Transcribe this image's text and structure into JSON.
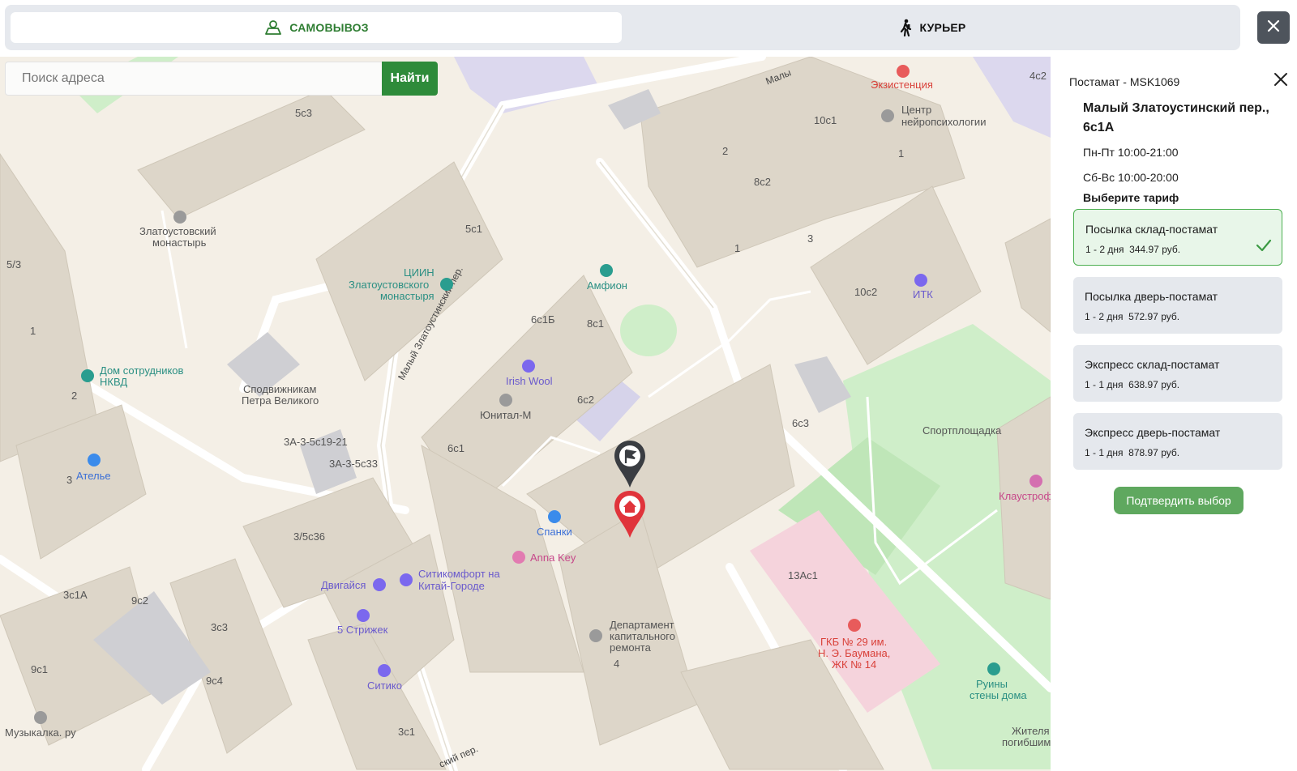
{
  "tabs": {
    "pickup_label": "САМОВЫВОЗ",
    "courier_label": "КУРЬЕР"
  },
  "search": {
    "placeholder": "Поиск адреса",
    "button_label": "Найти"
  },
  "map": {
    "labels": {
      "l_5c3": "5с3",
      "l_10c1": "10с1",
      "l_8c2": "8с2",
      "l_5c1": "5с1",
      "l_53": "5/3",
      "l_6c1b": "6с1Б",
      "l_8c1": "8с1",
      "l_10c2": "10с2",
      "l_6c2": "6с2",
      "l_6c3": "6с3",
      "l_6c1": "6с1",
      "l_3a19": "3А-3-5с19-21",
      "l_3a33": "3А-3-5с33",
      "l_35c36": "3/5с36",
      "l_3c1a": "3с1А",
      "l_9c2": "9с2",
      "l_3c3": "3с3",
      "l_9c1": "9с1",
      "l_9c4": "9с4",
      "l_3c1": "3с1",
      "l_13ac1": "13Ас1",
      "l_4": "4",
      "l_4c2": "4с2",
      "n_2a": "2",
      "n_1a": "1",
      "n_1b": "1",
      "n_3a": "3",
      "n_1c": "1",
      "n_2b": "2",
      "n_3b": "3",
      "ekzist": "Экзистенция",
      "center1": "Центр",
      "center2": "нейропсихологии",
      "monastery1": "Златоустовский",
      "monastery2": "монастырь",
      "ciin1": "ЦИИН",
      "ciin2": "Златоустовского",
      "ciin3": "монастыря",
      "amfion": "Амфион",
      "itk": "ИТК",
      "nkvd1": "Дом сотрудников",
      "nkvd2": "НКВД",
      "petr1": "Сподвижникам",
      "petr2": "Петра Великого",
      "irish": "Irish Wool",
      "unital": "Юнитал-М",
      "sport": "Спортплощадка",
      "atelier": "Ателье",
      "klaustro": "Клаустроф",
      "spanki": "Спанки",
      "anna": "Anna Key",
      "dvigaisya": "Двигайся",
      "citi1": "Ситикомфорт на",
      "citi2": "Китай-Городе",
      "strizh": "5 Стрижек",
      "sitiko": "Ситико",
      "dep1": "Департамент",
      "dep2": "капитального",
      "dep3": "ремонта",
      "gkb1": "ГКБ № 29 им.",
      "gkb2": "Н. Э. Баумана,",
      "gkb3": "ЖК № 14",
      "ruins1": "Руины",
      "ruins2": "стены дома",
      "music": "Музыкалка. ру",
      "zhit1": "Жителя",
      "zhit2": "погибшим",
      "street_malyi": "Малый Златоустинский пер.",
      "street_top": "Малы",
      "street_bottom": "ский пер."
    }
  },
  "panel": {
    "header": "Постамат - MSK1069",
    "address": "Малый Златоустинский пер., 6с1А",
    "hours_weekday": "Пн-Пт 10:00-21:00",
    "hours_weekend": "Сб-Вс 10:00-20:00",
    "tariff_title": "Выберите тариф",
    "tariffs": [
      {
        "name": "Посылка склад-постамат",
        "days": "1 - 2 дня",
        "price": "344.97 руб.",
        "selected": true
      },
      {
        "name": "Посылка дверь-постамат",
        "days": "1 - 2 дня",
        "price": "572.97 руб.",
        "selected": false
      },
      {
        "name": "Экспресс склад-постамат",
        "days": "1 - 1 дня",
        "price": "638.97 руб.",
        "selected": false
      },
      {
        "name": "Экспресс дверь-постамат",
        "days": "1 - 1 дня",
        "price": "878.97 руб.",
        "selected": false
      }
    ],
    "confirm_label": "Подтвердить выбор"
  },
  "colors": {
    "accent_green": "#2e8b3a",
    "selected_border": "#4caf50",
    "pin_red": "#e0343b",
    "pin_dark": "#3a3d42"
  }
}
